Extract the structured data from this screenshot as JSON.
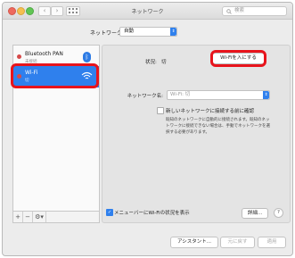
{
  "window": {
    "title": "ネットワーク"
  },
  "search": {
    "placeholder": "検索"
  },
  "location": {
    "label": "ネットワーク環境:",
    "value": "自動"
  },
  "services": [
    {
      "name": "Bluetooth PAN",
      "status": "未接続"
    },
    {
      "name": "Wi-Fi",
      "status": "切"
    }
  ],
  "detail": {
    "status_label": "状況:",
    "status_value": "切",
    "turn_on_button": "Wi-Fiを入にする",
    "network_name_label": "ネットワーク名:",
    "network_name_value": "Wi-Fi: 切",
    "ask_join_label": "新しいネットワークに接続する前に確認",
    "ask_join_note": "既知のネットワークに自動的に接続されます。既知のネットワークに接続できない場合は、手動でネットワークを選択する必要があります。",
    "menubar_label": "メニューバーにWi-Fiの状況を表示",
    "advanced_button": "詳細...",
    "help": "?"
  },
  "footer": {
    "assist": "アシスタント...",
    "revert": "元に戻す",
    "apply": "適用"
  },
  "colors": {
    "accent": "#2f80ed",
    "highlight": "#e8141c"
  }
}
